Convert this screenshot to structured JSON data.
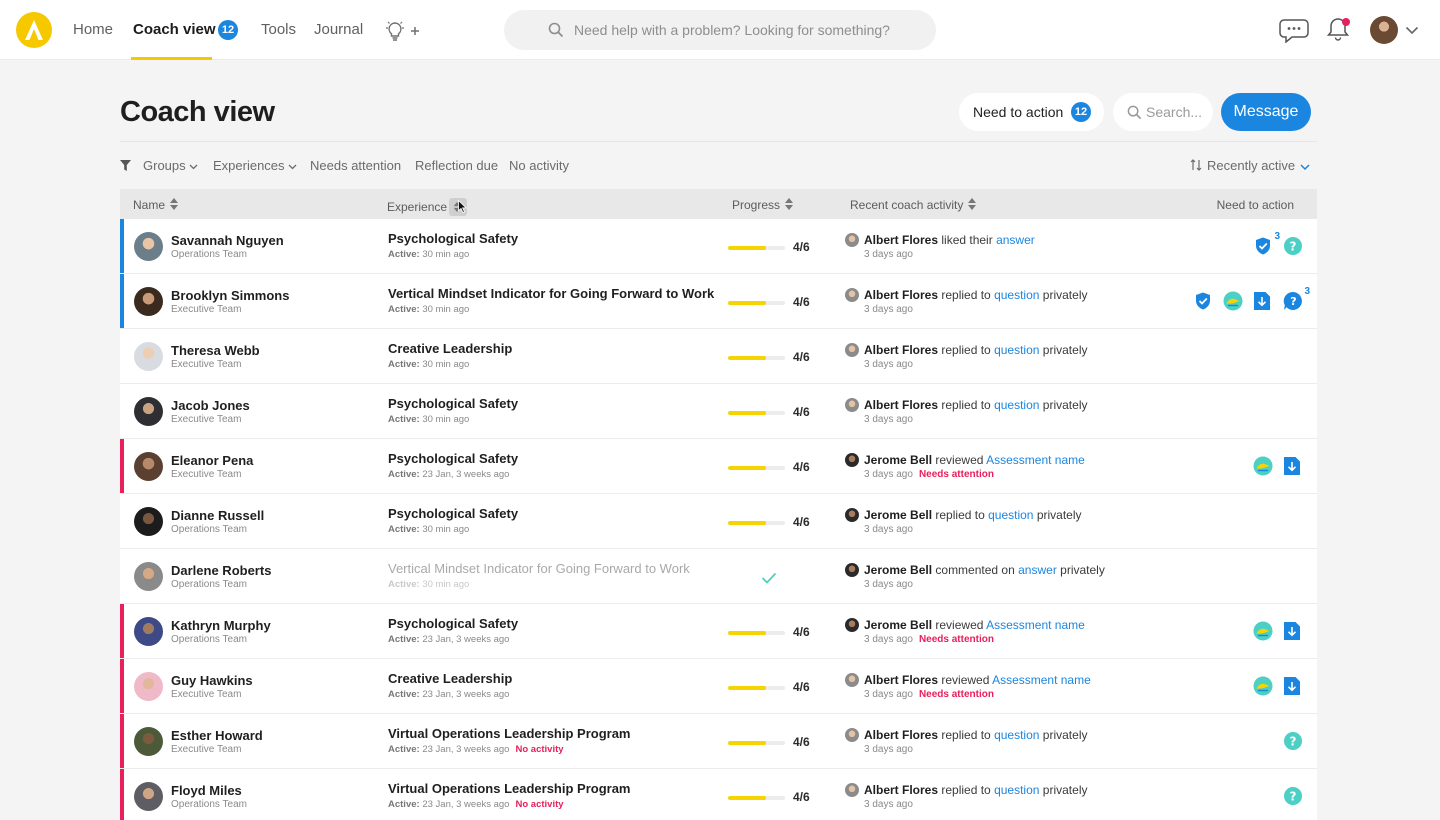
{
  "nav": {
    "logo_letter": "A",
    "home": "Home",
    "coach_view": "Coach view",
    "coach_view_badge": "12",
    "tools": "Tools",
    "journal": "Journal",
    "search_placeholder": "Need help with a problem? Looking for something?"
  },
  "page": {
    "title": "Coach view",
    "need_to_action_label": "Need to action",
    "need_to_action_count": "12",
    "search_placeholder": "Search...",
    "message_label": "Message"
  },
  "filters": {
    "groups": "Groups",
    "experiences": "Experiences",
    "needs_attention": "Needs attention",
    "reflection_due": "Reflection due",
    "no_activity": "No activity",
    "sort_label": "Recently active"
  },
  "table": {
    "columns": {
      "name": "Name",
      "experience": "Experience",
      "progress": "Progress",
      "recent": "Recent coach activity",
      "need": "Need to action"
    },
    "active_prefix": "Active:",
    "rows": [
      {
        "name": "Savannah Nguyen",
        "team": "Operations Team",
        "marker": "blue",
        "avatar": "av-1",
        "experience": "Psychological Safety",
        "active": "30 min ago",
        "active_flag": "",
        "progress_label": "4/6",
        "progress": 0.67,
        "completed": false,
        "muted": false,
        "coach": "Albert Flores",
        "coach_avatar": "albert",
        "verb": "liked their",
        "link": "answer",
        "suffix": "",
        "ago": "3 days ago",
        "ago_flag": "",
        "needs": [
          {
            "icon": "shield-check-icon",
            "count": "3"
          },
          {
            "icon": "question-icon",
            "count": ""
          }
        ]
      },
      {
        "name": "Brooklyn Simmons",
        "team": "Executive Team",
        "marker": "blue",
        "avatar": "av-2",
        "experience": "Vertical Mindset Indicator for Going Forward to Work",
        "active": "30 min ago",
        "active_flag": "",
        "progress_label": "4/6",
        "progress": 0.67,
        "completed": false,
        "muted": false,
        "coach": "Albert Flores",
        "coach_avatar": "albert",
        "verb": "replied to",
        "link": "question",
        "suffix": "privately",
        "ago": "3 days ago",
        "ago_flag": "",
        "needs": [
          {
            "icon": "shield-check-icon",
            "count": ""
          },
          {
            "icon": "reflection-icon",
            "count": ""
          },
          {
            "icon": "download-doc-icon",
            "count": ""
          },
          {
            "icon": "question-chat-icon",
            "count": "3"
          }
        ]
      },
      {
        "name": "Theresa Webb",
        "team": "Executive Team",
        "marker": "",
        "avatar": "av-3",
        "experience": "Creative Leadership",
        "active": "30 min ago",
        "active_flag": "",
        "progress_label": "4/6",
        "progress": 0.67,
        "completed": false,
        "muted": false,
        "coach": "Albert Flores",
        "coach_avatar": "albert",
        "verb": "replied to",
        "link": "question",
        "suffix": "privately",
        "ago": "3 days ago",
        "ago_flag": "",
        "needs": []
      },
      {
        "name": "Jacob Jones",
        "team": "Executive Team",
        "marker": "",
        "avatar": "av-4",
        "experience": "Psychological Safety",
        "active": "30 min ago",
        "active_flag": "",
        "progress_label": "4/6",
        "progress": 0.67,
        "completed": false,
        "muted": false,
        "coach": "Albert Flores",
        "coach_avatar": "albert",
        "verb": "replied to",
        "link": "question",
        "suffix": "privately",
        "ago": "3 days ago",
        "ago_flag": "",
        "needs": []
      },
      {
        "name": "Eleanor Pena",
        "team": "Executive Team",
        "marker": "pink",
        "avatar": "av-5",
        "experience": "Psychological Safety",
        "active": "23 Jan, 3 weeks ago",
        "active_flag": "",
        "progress_label": "4/6",
        "progress": 0.67,
        "completed": false,
        "muted": false,
        "coach": "Jerome Bell",
        "coach_avatar": "jerome",
        "verb": "reviewed",
        "link": "Assessment name",
        "suffix": "",
        "ago": "3 days ago",
        "ago_flag": "Needs attention",
        "needs": [
          {
            "icon": "reflection-icon",
            "count": ""
          },
          {
            "icon": "download-doc-icon",
            "count": ""
          }
        ]
      },
      {
        "name": "Dianne Russell",
        "team": "Operations Team",
        "marker": "",
        "avatar": "av-6",
        "experience": "Psychological Safety",
        "active": "30 min ago",
        "active_flag": "",
        "progress_label": "4/6",
        "progress": 0.67,
        "completed": false,
        "muted": false,
        "coach": "Jerome Bell",
        "coach_avatar": "jerome",
        "verb": "replied to",
        "link": "question",
        "suffix": "privately",
        "ago": "3 days ago",
        "ago_flag": "",
        "needs": []
      },
      {
        "name": "Darlene Roberts",
        "team": "Operations Team",
        "marker": "",
        "avatar": "av-7",
        "experience": "Vertical Mindset Indicator for Going Forward to Work",
        "active": "30 min ago",
        "active_flag": "",
        "progress_label": "",
        "progress": 1,
        "completed": true,
        "muted": true,
        "coach": "Jerome Bell",
        "coach_avatar": "jerome",
        "verb": "commented on",
        "link": "answer",
        "suffix": "privately",
        "ago": "3 days ago",
        "ago_flag": "",
        "needs": []
      },
      {
        "name": "Kathryn Murphy",
        "team": "Operations Team",
        "marker": "pink",
        "avatar": "av-8",
        "experience": "Psychological Safety",
        "active": "23 Jan, 3 weeks ago",
        "active_flag": "",
        "progress_label": "4/6",
        "progress": 0.67,
        "completed": false,
        "muted": false,
        "coach": "Jerome Bell",
        "coach_avatar": "jerome",
        "verb": "reviewed",
        "link": "Assessment name",
        "suffix": "",
        "ago": "3 days ago",
        "ago_flag": "Needs attention",
        "needs": [
          {
            "icon": "reflection-icon",
            "count": ""
          },
          {
            "icon": "download-doc-icon",
            "count": ""
          }
        ]
      },
      {
        "name": "Guy Hawkins",
        "team": "Executive Team",
        "marker": "pink",
        "avatar": "av-9",
        "experience": "Creative Leadership",
        "active": "23 Jan, 3 weeks ago",
        "active_flag": "",
        "progress_label": "4/6",
        "progress": 0.67,
        "completed": false,
        "muted": false,
        "coach": "Albert Flores",
        "coach_avatar": "albert",
        "verb": "reviewed",
        "link": "Assessment name",
        "suffix": "",
        "ago": "3 days ago",
        "ago_flag": "Needs attention",
        "needs": [
          {
            "icon": "reflection-icon",
            "count": ""
          },
          {
            "icon": "download-doc-icon",
            "count": ""
          }
        ]
      },
      {
        "name": "Esther Howard",
        "team": "Executive Team",
        "marker": "pink",
        "avatar": "av-10",
        "experience": "Virtual Operations Leadership Program",
        "active": "23 Jan, 3 weeks ago",
        "active_flag": "No activity",
        "progress_label": "4/6",
        "progress": 0.67,
        "completed": false,
        "muted": false,
        "coach": "Albert Flores",
        "coach_avatar": "albert",
        "verb": "replied to",
        "link": "question",
        "suffix": "privately",
        "ago": "3 days ago",
        "ago_flag": "",
        "needs": [
          {
            "icon": "question-icon",
            "count": ""
          }
        ]
      },
      {
        "name": "Floyd Miles",
        "team": "Operations Team",
        "marker": "pink",
        "avatar": "av-11",
        "experience": "Virtual Operations Leadership Program",
        "active": "23 Jan, 3 weeks ago",
        "active_flag": "No activity",
        "progress_label": "4/6",
        "progress": 0.67,
        "completed": false,
        "muted": false,
        "coach": "Albert Flores",
        "coach_avatar": "albert",
        "verb": "replied to",
        "link": "question",
        "suffix": "privately",
        "ago": "3 days ago",
        "ago_flag": "",
        "needs": [
          {
            "icon": "question-icon",
            "count": ""
          }
        ]
      }
    ]
  },
  "colors": {
    "accent_blue": "#1a86e0",
    "brand_yellow": "#f5c800",
    "alert_pink": "#e8205b",
    "teal": "#4ccfc4"
  }
}
